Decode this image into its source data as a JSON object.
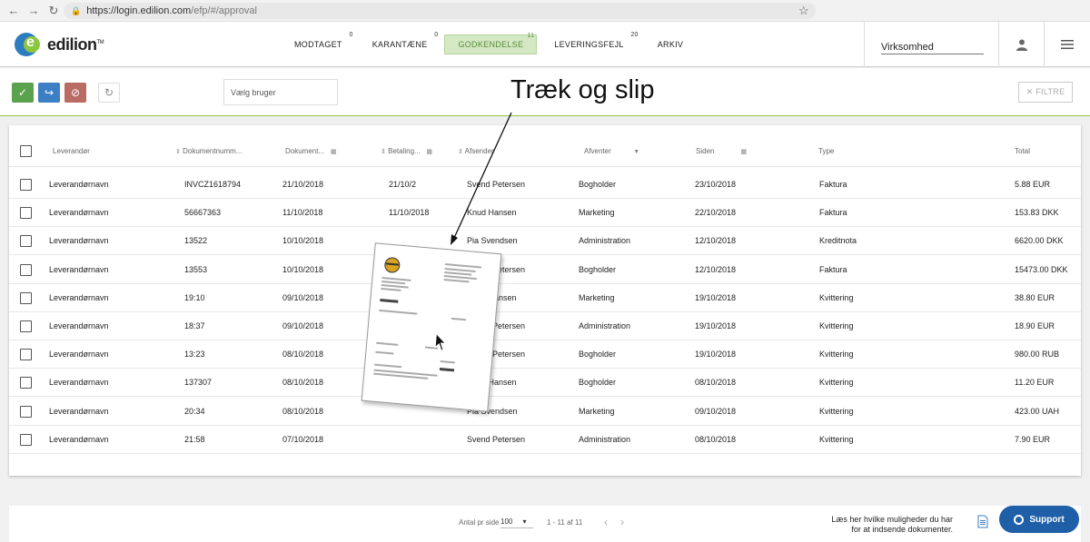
{
  "browser": {
    "url_host": "https://login.edilion.com",
    "url_path": "/efp/#/approval"
  },
  "logo": {
    "text": "edilion",
    "mark": "e",
    "tm": "TM"
  },
  "tabs": [
    {
      "label": "MODTAGET",
      "count": "0"
    },
    {
      "label": "KARANTÆNE",
      "count": "0"
    },
    {
      "label": "GODKENDELSE",
      "count": "11"
    },
    {
      "label": "LEVERINGSFEJL",
      "count": "20"
    },
    {
      "label": "ARKIV",
      "count": ""
    }
  ],
  "company": {
    "value": "Virksomhed"
  },
  "toolbar": {
    "user_placeholder": "Vælg bruger",
    "filter_label": "✕ FILTRE",
    "colors": {
      "approve": "#5aa24e",
      "forward": "#3d7fc3",
      "reject": "#b96b64"
    }
  },
  "annotation": "Træk og slip",
  "table": {
    "headers": {
      "supplier": "Leverandør",
      "docnum": "Dokumentnumm...",
      "docdate": "Dokument...",
      "payment": "Betaling...",
      "sender": "Afsender",
      "awaiting": "Afventer",
      "since": "Siden",
      "type": "Type",
      "total": "Total"
    },
    "rows": [
      {
        "supplier": "Leverandørnavn",
        "docnum": "INVCZ1618794",
        "docdate": "21/10/2018",
        "payment": "21/10/2",
        "sender": "Svend Petersen",
        "awaiting": "Bogholder",
        "since": "23/10/2018",
        "type": "Faktura",
        "total": "5.88 EUR"
      },
      {
        "supplier": "Leverandørnavn",
        "docnum": "56667363",
        "docdate": "11/10/2018",
        "payment": "11/10/2018",
        "sender": "Knud Hansen",
        "awaiting": "Marketing",
        "since": "22/10/2018",
        "type": "Faktura",
        "total": "153.83 DKK"
      },
      {
        "supplier": "Leverandørnavn",
        "docnum": "13522",
        "docdate": "10/10/2018",
        "payment": "",
        "sender": "Pia Svendsen",
        "awaiting": "Administration",
        "since": "12/10/2018",
        "type": "Kreditnota",
        "total": "6620.00 DKK"
      },
      {
        "supplier": "Leverandørnavn",
        "docnum": "13553",
        "docdate": "10/10/2018",
        "payment": "",
        "sender": "Svend Petersen",
        "awaiting": "Bogholder",
        "since": "12/10/2018",
        "type": "Faktura",
        "total": "15473.00 DKK"
      },
      {
        "supplier": "Leverandørnavn",
        "docnum": "19:10",
        "docdate": "09/10/2018",
        "payment": "",
        "sender": "Knud Hansen",
        "awaiting": "Marketing",
        "since": "19/10/2018",
        "type": "Kvittering",
        "total": "38.80 EUR"
      },
      {
        "supplier": "Leverandørnavn",
        "docnum": "18:37",
        "docdate": "09/10/2018",
        "payment": "",
        "sender": "Svend Petersen",
        "awaiting": "Administration",
        "since": "19/10/2018",
        "type": "Kvittering",
        "total": "18.90 EUR"
      },
      {
        "supplier": "Leverandørnavn",
        "docnum": "13:23",
        "docdate": "08/10/2018",
        "payment": "",
        "sender": "Svend Petersen",
        "awaiting": "Bogholder",
        "since": "19/10/2018",
        "type": "Kvittering",
        "total": "980.00 RUB"
      },
      {
        "supplier": "Leverandørnavn",
        "docnum": "137307",
        "docdate": "08/10/2018",
        "payment": "",
        "sender": "Knud Hansen",
        "awaiting": "Bogholder",
        "since": "08/10/2018",
        "type": "Kvittering",
        "total": "11.20 EUR"
      },
      {
        "supplier": "Leverandørnavn",
        "docnum": "20:34",
        "docdate": "08/10/2018",
        "payment": "",
        "sender": "Pia Svendsen",
        "awaiting": "Marketing",
        "since": "09/10/2018",
        "type": "Kvittering",
        "total": "423.00 UAH"
      },
      {
        "supplier": "Leverandørnavn",
        "docnum": "21:58",
        "docdate": "07/10/2018",
        "payment": "",
        "sender": "Svend Petersen",
        "awaiting": "Administration",
        "since": "08/10/2018",
        "type": "Kvittering",
        "total": "7.90 EUR"
      }
    ]
  },
  "footer": {
    "per_page_label": "Antal pr side",
    "per_page_value": "100",
    "range": "1 - 11 af 11",
    "hint": "Læs her hvilke muligheder du har for at indsende dokumenter.",
    "support": "Support"
  }
}
